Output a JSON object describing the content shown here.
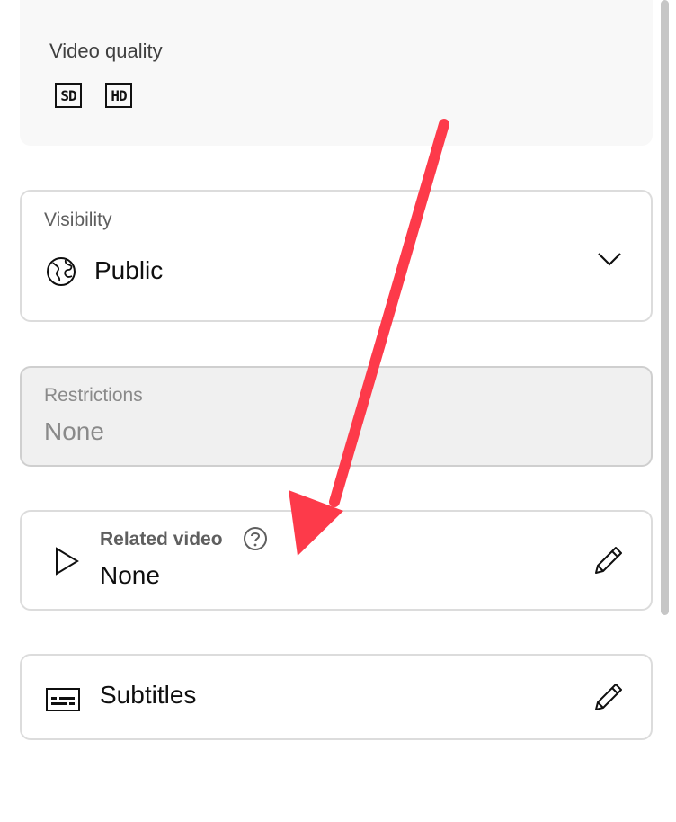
{
  "video_quality": {
    "label": "Video quality",
    "badges": [
      "SD",
      "HD"
    ]
  },
  "visibility": {
    "label": "Visibility",
    "value": "Public",
    "icon": "globe-icon",
    "dropdown_icon": "chevron-down-icon"
  },
  "restrictions": {
    "label": "Restrictions",
    "value": "None"
  },
  "related_video": {
    "label": "Related video",
    "value": "None",
    "icon": "play-icon",
    "help_icon": "help-circle-icon",
    "edit_icon": "pencil-icon"
  },
  "subtitles": {
    "label": "Subtitles",
    "icon": "subtitles-icon",
    "edit_icon": "pencil-icon"
  },
  "annotation": {
    "arrow_color": "#fd3a4a"
  }
}
